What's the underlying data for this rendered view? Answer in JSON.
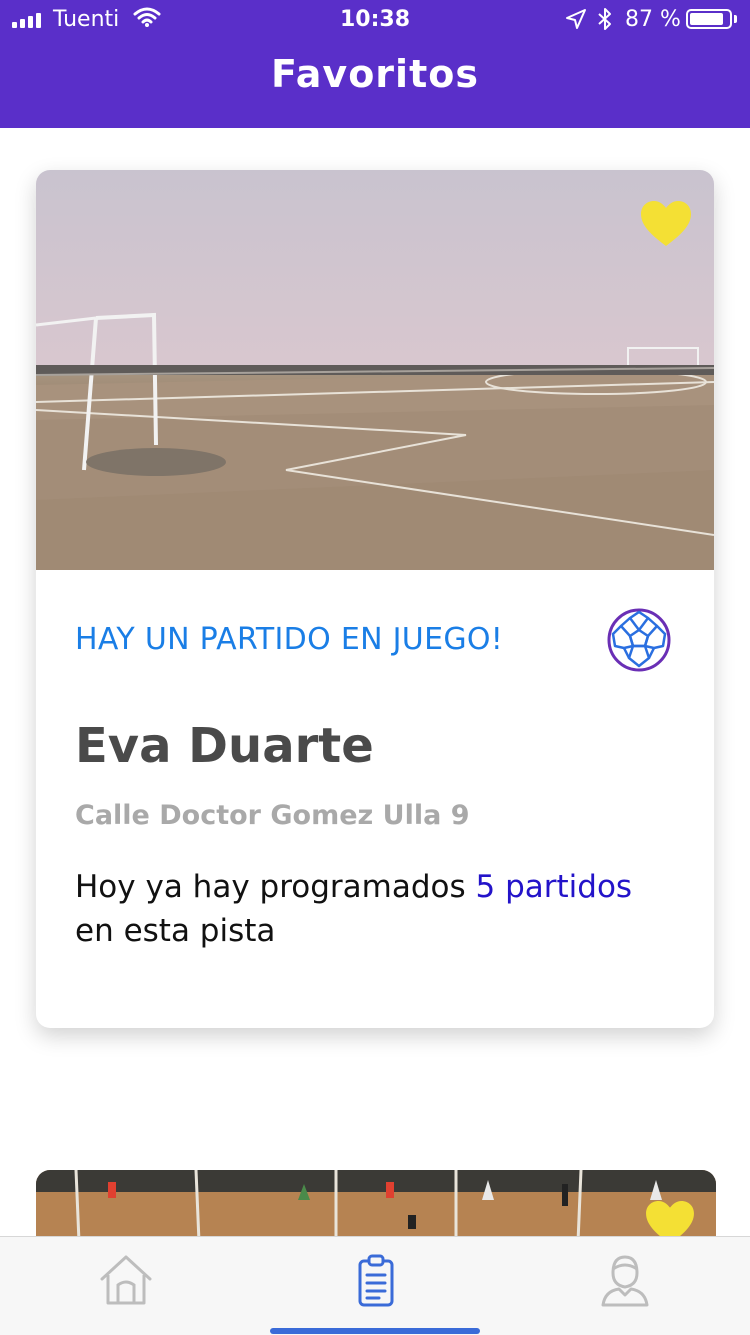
{
  "status_bar": {
    "carrier": "Tuenti",
    "time": "10:38",
    "battery_percent": "87 %",
    "battery_level": 0.87
  },
  "header": {
    "title": "Favoritos"
  },
  "cards": [
    {
      "favorite": true,
      "status": "HAY UN PARTIDO EN JUEGO!",
      "sport_icon": "soccer-ball-icon",
      "name": "Eva Duarte",
      "address": "Calle Doctor Gomez Ulla 9",
      "desc_prefix": "Hoy ya hay programados ",
      "desc_highlight": "5 partidos",
      "desc_suffix": "en esta pista"
    },
    {
      "favorite": true
    }
  ],
  "tab_bar": {
    "items": [
      {
        "icon": "home-icon",
        "active": false
      },
      {
        "icon": "clipboard-list-icon",
        "active": true
      },
      {
        "icon": "profile-icon",
        "active": false
      }
    ]
  },
  "colors": {
    "brand": "#5a2fc9",
    "status_blue": "#1a7ee6",
    "highlight": "#2313c9",
    "heart": "#f4e034",
    "tab_active": "#3a6bd8"
  }
}
